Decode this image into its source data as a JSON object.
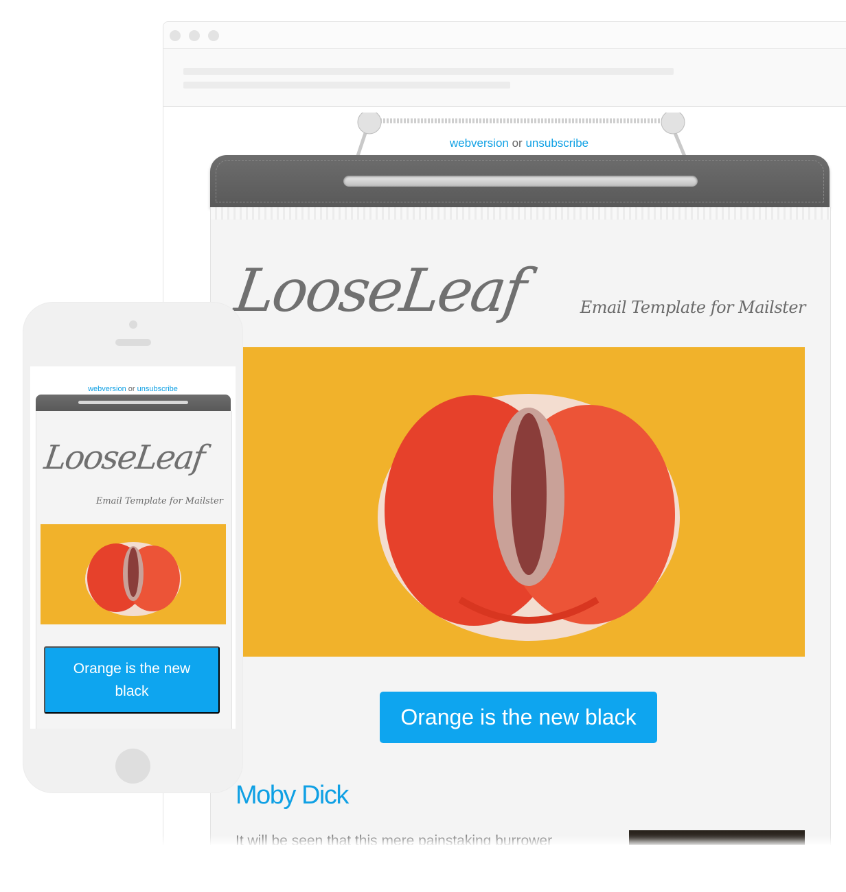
{
  "email": {
    "webversion_label": "webversion",
    "or_label": "or",
    "unsubscribe_label": "unsubscribe",
    "logo_text": "LooseLeaf",
    "tagline": "Email Template for Mailster",
    "cta_label": "Orange is the new black",
    "article_title": "Moby Dick",
    "article_text": "It will be seen that this mere painstaking burrower"
  },
  "colors": {
    "link": "#0fa0e4",
    "button": "#0ea5ef",
    "hero_bg": "#f1b22b",
    "clipboard": "#626262"
  },
  "icons": {
    "hero_image": "grapefruit-image",
    "article_image": "dark-photo"
  }
}
